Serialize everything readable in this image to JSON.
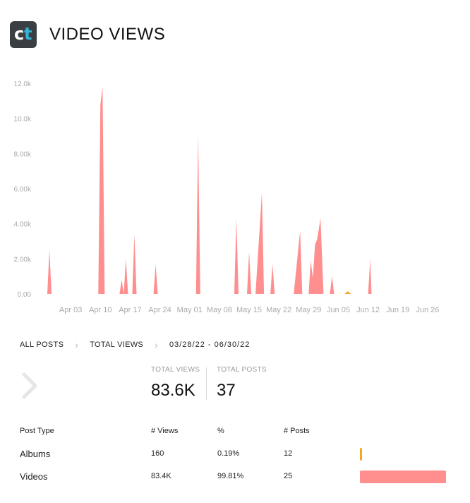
{
  "header": {
    "title": "VIDEO VIEWS",
    "logo_c": "c",
    "logo_t": "t"
  },
  "chart_data": {
    "type": "area",
    "series": [
      {
        "values": [
          [
            0.5,
            0
          ],
          [
            1,
            2500
          ],
          [
            1.5,
            0
          ],
          [
            12.5,
            0
          ],
          [
            13,
            10800
          ],
          [
            13.5,
            11800
          ],
          [
            14,
            0
          ],
          [
            17.5,
            0
          ],
          [
            18,
            800
          ],
          [
            18.5,
            0
          ],
          [
            19,
            2000
          ],
          [
            19.5,
            0
          ],
          [
            20.5,
            0
          ],
          [
            21,
            3400
          ],
          [
            21.5,
            0
          ],
          [
            25.5,
            0
          ],
          [
            26,
            1700
          ],
          [
            26.5,
            0
          ],
          [
            35.5,
            0
          ],
          [
            36,
            9100
          ],
          [
            36.5,
            0
          ],
          [
            44.5,
            0
          ],
          [
            45,
            4300
          ],
          [
            45.5,
            0
          ],
          [
            47.5,
            0
          ],
          [
            48,
            2400
          ],
          [
            48.5,
            0
          ],
          [
            49.5,
            0
          ],
          [
            50.5,
            3800
          ],
          [
            51,
            5800
          ],
          [
            51.5,
            0
          ],
          [
            53,
            0
          ],
          [
            53.5,
            1700
          ],
          [
            54,
            0
          ],
          [
            58.5,
            0
          ],
          [
            60,
            3600
          ],
          [
            60.5,
            0
          ],
          [
            62,
            0
          ],
          [
            62.5,
            1900
          ],
          [
            63,
            900
          ],
          [
            63.5,
            2800
          ],
          [
            64,
            3100
          ],
          [
            64.8,
            4300
          ],
          [
            65.5,
            0
          ],
          [
            67,
            0
          ],
          [
            67.5,
            1000
          ],
          [
            68,
            0
          ],
          [
            76,
            0
          ],
          [
            76.5,
            2000
          ],
          [
            76.8,
            0
          ]
        ],
        "color": "#ff8e8e"
      },
      {
        "values": [
          [
            70.5,
            0
          ],
          [
            71.2,
            150
          ],
          [
            72,
            0
          ]
        ],
        "color": "#f5a623"
      }
    ],
    "x_ticks": [
      {
        "x": 6,
        "label": "Apr 03"
      },
      {
        "x": 13,
        "label": "Apr 10"
      },
      {
        "x": 20,
        "label": "Apr 17"
      },
      {
        "x": 27,
        "label": "Apr 24"
      },
      {
        "x": 34,
        "label": "May 01"
      },
      {
        "x": 41,
        "label": "May 08"
      },
      {
        "x": 48,
        "label": "May 15"
      },
      {
        "x": 55,
        "label": "May 22"
      },
      {
        "x": 62,
        "label": "May 29"
      },
      {
        "x": 69,
        "label": "Jun 05"
      },
      {
        "x": 76,
        "label": "Jun 12"
      },
      {
        "x": 83,
        "label": "Jun 19"
      },
      {
        "x": 90,
        "label": "Jun 26"
      }
    ],
    "y_ticks": [
      {
        "v": 0,
        "label": "0.00"
      },
      {
        "v": 2000,
        "label": "2.00k"
      },
      {
        "v": 4000,
        "label": "4.00k"
      },
      {
        "v": 6000,
        "label": "6.00k"
      },
      {
        "v": 8000,
        "label": "8.00k"
      },
      {
        "v": 10000,
        "label": "10.0k"
      },
      {
        "v": 12000,
        "label": "12.0k"
      }
    ],
    "xlim": [
      0,
      94
    ],
    "ylim": [
      0,
      12000
    ],
    "grid": false
  },
  "breadcrumb": {
    "all_posts": "ALL POSTS",
    "total_views": "TOTAL VIEWS",
    "range": "03/28/22 - 06/30/22"
  },
  "stats": {
    "total_views_label": "TOTAL VIEWS",
    "total_views_value": "83.6K",
    "total_posts_label": "TOTAL POSTS",
    "total_posts_value": "37"
  },
  "table": {
    "headers": [
      "Post Type",
      "# Views",
      "%",
      "# Posts"
    ],
    "rows": [
      {
        "type": "Albums",
        "views": "160",
        "pct": "0.19%",
        "posts": "12",
        "share": 0.0019,
        "color": "#f5a623"
      },
      {
        "type": "Videos",
        "views": "83.4K",
        "pct": "99.81%",
        "posts": "25",
        "share": 0.9981,
        "color": "#ff8e8e"
      }
    ]
  }
}
